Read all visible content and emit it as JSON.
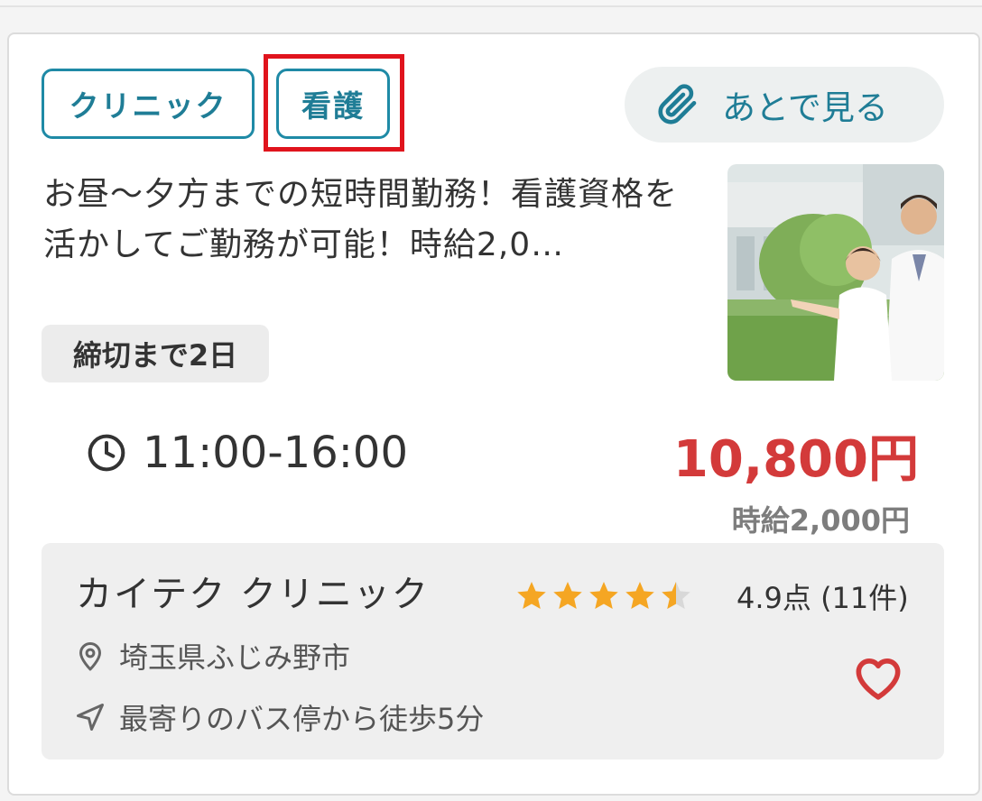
{
  "tags": {
    "clinic": "クリニック",
    "nursing": "看護"
  },
  "watch_later": {
    "label": "あとで見る",
    "icon": "paperclip-icon"
  },
  "job": {
    "title": "お昼〜夕方までの短時間勤務！看護資格を活かしてご勤務が可能！時給2,0…",
    "deadline": "締切まで2日",
    "time": "11:00-16:00",
    "price": "10,800円",
    "hourly": "時給2,000円"
  },
  "facility": {
    "name": "カイテク クリニック",
    "rating": 4.9,
    "rating_text": "4.9点 (11件)",
    "location": "埼玉県ふじみ野市",
    "access": "最寄りのバス停から徒歩5分"
  },
  "colors": {
    "accent": "#1f8aa6",
    "price": "#d33a3a",
    "highlight": "#e0141d",
    "star": "#f5a623"
  }
}
